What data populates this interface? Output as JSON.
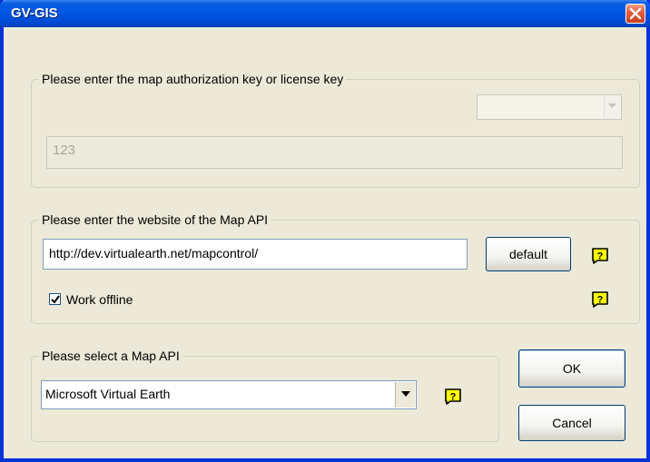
{
  "window": {
    "title": "GV-GIS"
  },
  "license_group": {
    "legend": "Please enter the map authorization key or license key",
    "key_type_select_value": "",
    "license_key_value": "123"
  },
  "website_group": {
    "legend": "Please enter the website of the Map API",
    "url_value": "http://dev.virtualearth.net/mapcontrol/",
    "default_button_label": "default",
    "work_offline_label": "Work offline",
    "work_offline_checked": true
  },
  "api_group": {
    "legend": "Please select a Map API",
    "selected_api": "Microsoft Virtual Earth"
  },
  "buttons": {
    "ok_label": "OK",
    "cancel_label": "Cancel"
  },
  "icons": {
    "help_icon": "question-mark-help-icon",
    "close_icon": "close-x-icon",
    "dropdown_icon": "chevron-down-icon",
    "check_icon": "checkmark-icon"
  },
  "colors": {
    "title_bar": "#0054e3",
    "dialog_bg": "#ece9d8",
    "help_icon_yellow": "#ffff00",
    "close_button": "#e35a3a"
  }
}
